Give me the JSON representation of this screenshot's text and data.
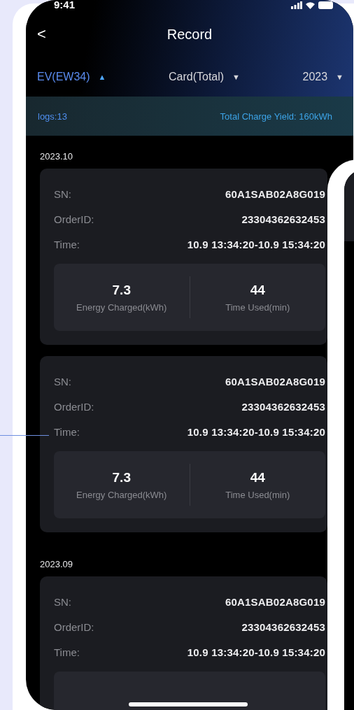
{
  "status_bar": {
    "time": "9:41"
  },
  "nav": {
    "back": "<",
    "title": "Record"
  },
  "filters": [
    {
      "label": "EV(EW34)",
      "caret": "▲",
      "selected": true
    },
    {
      "label": "Card(Total)",
      "caret": "▼",
      "selected": false
    },
    {
      "label": "2023",
      "caret": "▼",
      "selected": false
    }
  ],
  "summary": {
    "logs": "logs:13",
    "total": "Total Charge Yield: 160kWh"
  },
  "sections": [
    {
      "month": "2023.10",
      "records": [
        {
          "fields": [
            {
              "label": "SN:",
              "value": "60A1SAB02A8G019"
            },
            {
              "label": "OrderID:",
              "value": "23304362632453"
            },
            {
              "label": "Time:",
              "value": "10.9 13:34:20-10.9 15:34:20"
            }
          ],
          "stats": [
            {
              "value": "7.3",
              "label": "Energy Charged(kWh)"
            },
            {
              "value": "44",
              "label": "Time Used(min)"
            }
          ]
        },
        {
          "fields": [
            {
              "label": "SN:",
              "value": "60A1SAB02A8G019"
            },
            {
              "label": "OrderID:",
              "value": "23304362632453"
            },
            {
              "label": "Time:",
              "value": "10.9 13:34:20-10.9 15:34:20"
            }
          ],
          "stats": [
            {
              "value": "7.3",
              "label": "Energy Charged(kWh)"
            },
            {
              "value": "44",
              "label": "Time Used(min)"
            }
          ]
        }
      ]
    },
    {
      "month": "2023.09",
      "records": [
        {
          "fields": [
            {
              "label": "SN:",
              "value": "60A1SAB02A8G019"
            },
            {
              "label": "OrderID:",
              "value": "23304362632453"
            },
            {
              "label": "Time:",
              "value": "10.9 13:34:20-10.9 15:34:20"
            }
          ]
        }
      ]
    }
  ]
}
